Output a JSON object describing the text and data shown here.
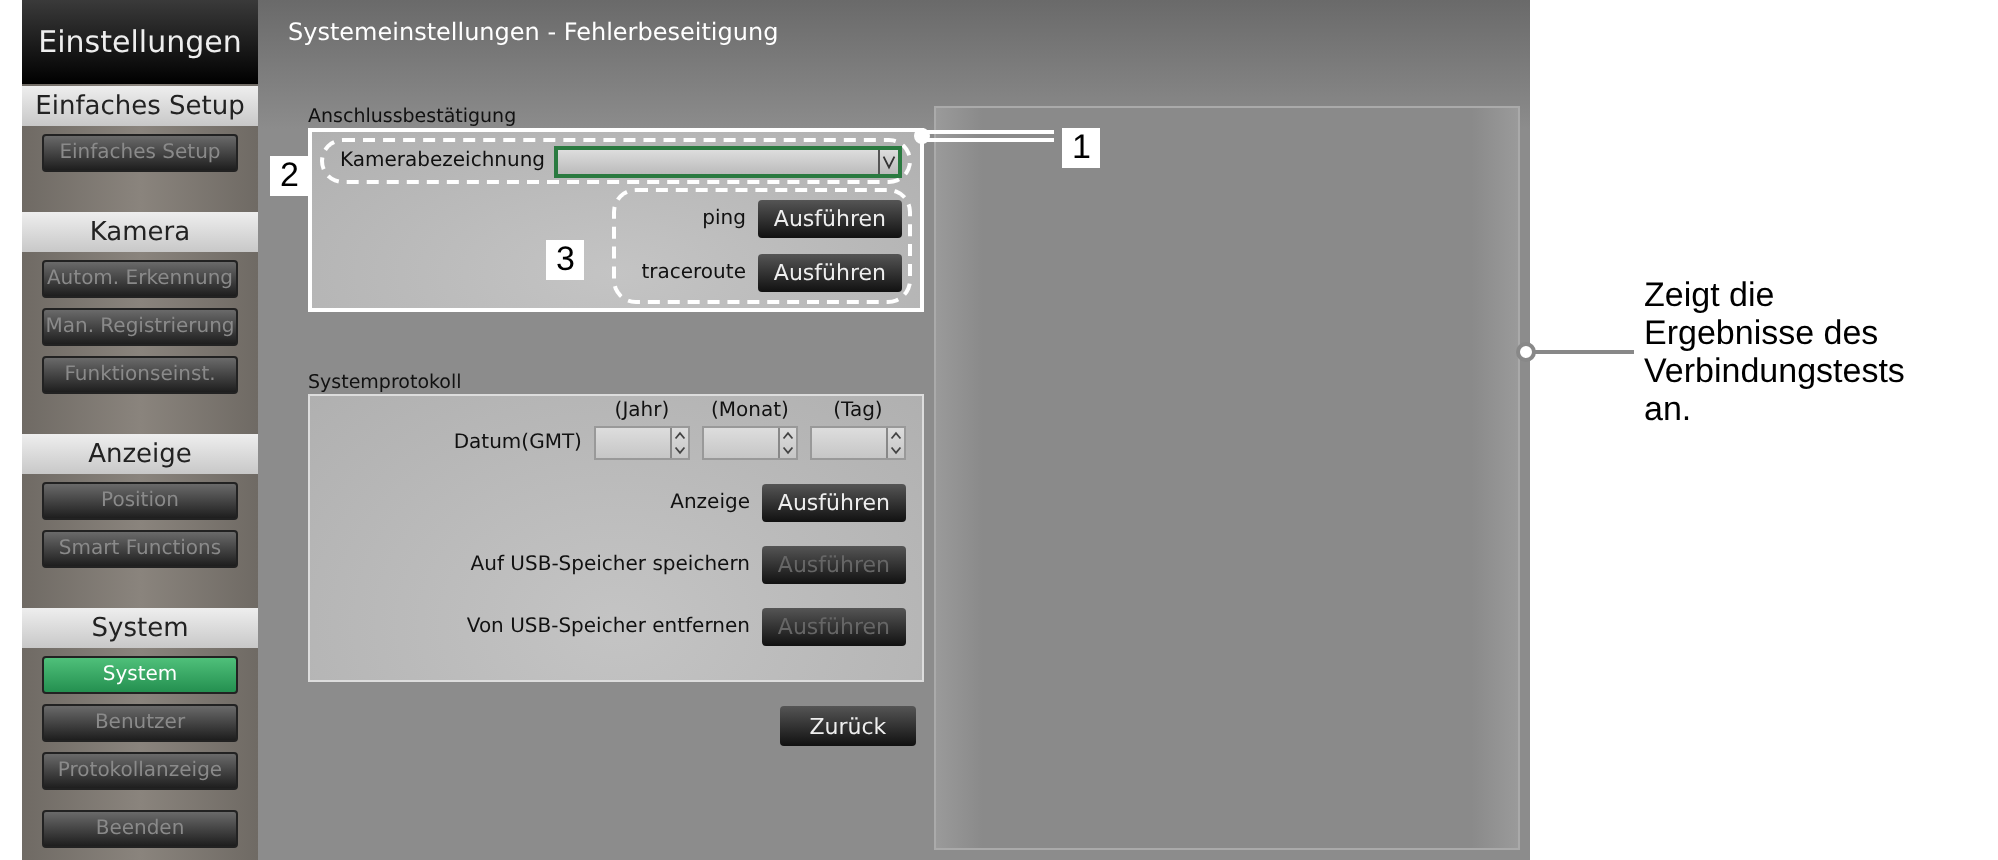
{
  "sidebar": {
    "title": "Einstellungen",
    "groups": [
      {
        "heading": "Einfaches Setup",
        "items": [
          {
            "label": "Einfaches Setup",
            "selected": false
          }
        ]
      },
      {
        "heading": "Kamera",
        "items": [
          {
            "label": "Autom. Erkennung",
            "selected": false
          },
          {
            "label": "Man. Registrierung",
            "selected": false
          },
          {
            "label": "Funktionseinst.",
            "selected": false
          }
        ]
      },
      {
        "heading": "Anzeige",
        "items": [
          {
            "label": "Position",
            "selected": false
          },
          {
            "label": "Smart Functions",
            "selected": false
          }
        ]
      },
      {
        "heading": "System",
        "items": [
          {
            "label": "System",
            "selected": true
          },
          {
            "label": "Benutzer",
            "selected": false
          },
          {
            "label": "Protokollanzeige",
            "selected": false
          }
        ]
      }
    ],
    "footer_button": "Beenden"
  },
  "page_title": "Systemeinstellungen - Fehlerbeseitigung",
  "connection": {
    "heading": "Anschlussbestätigung",
    "camera_label": "Kamerabezeichnung",
    "tests": [
      {
        "label": "ping",
        "button": "Ausführen"
      },
      {
        "label": "traceroute",
        "button": "Ausführen"
      }
    ]
  },
  "system_log": {
    "heading": "Systemprotokoll",
    "date_label": "Datum(GMT)",
    "date_parts": [
      "(Jahr)",
      "(Monat)",
      "(Tag)"
    ],
    "actions": [
      {
        "label": "Anzeige",
        "button": "Ausführen",
        "disabled": false
      },
      {
        "label": "Auf USB-Speicher speichern",
        "button": "Ausführen",
        "disabled": true
      },
      {
        "label": "Von USB-Speicher entfernen",
        "button": "Ausführen",
        "disabled": true
      }
    ]
  },
  "back_button": "Zurück",
  "annotations": {
    "markers": [
      "1",
      "2",
      "3"
    ],
    "result_note": "Zeigt die Ergebnisse des Verbindungstests an."
  }
}
